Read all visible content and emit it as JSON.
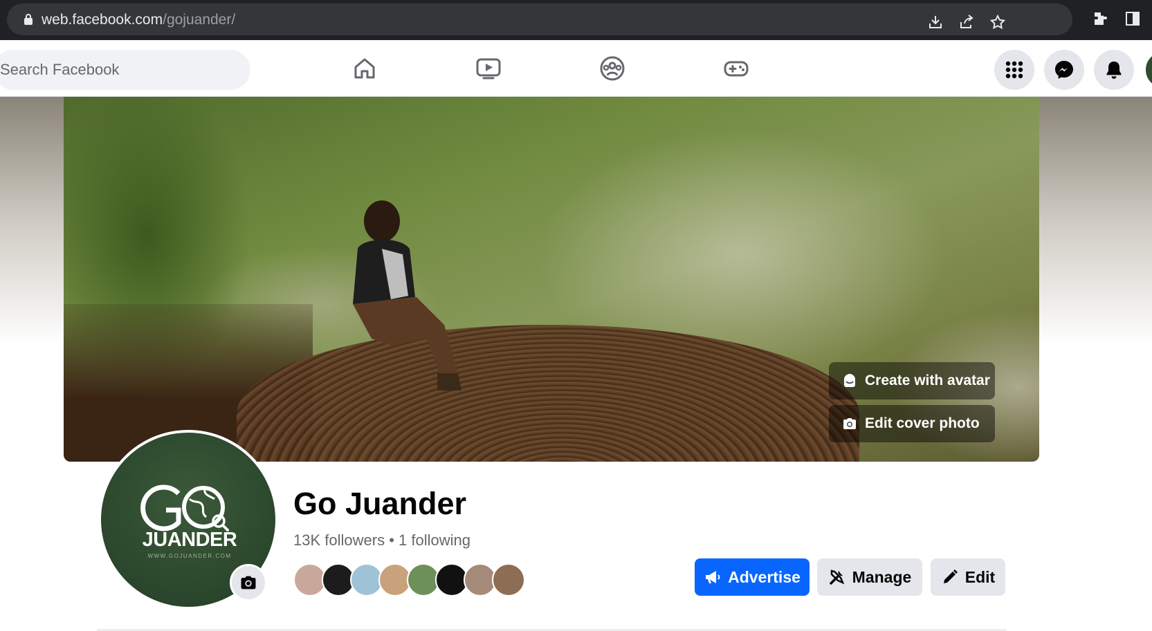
{
  "browser": {
    "url_host": "web.facebook.com",
    "url_path": "/gojuander/"
  },
  "search": {
    "placeholder": "Search Facebook"
  },
  "cover": {
    "create_avatar_label": "Create with avatar",
    "edit_cover_label": "Edit cover photo"
  },
  "avatar": {
    "logo_text": "GO JUANDER",
    "logo_url_text": "WWW.GOJUANDER.COM"
  },
  "profile": {
    "name": "Go Juander",
    "followers": "13K followers",
    "separator": " • ",
    "following": "1 following"
  },
  "friend_avatar_colors": [
    "#c9a89b",
    "#1c1c1c",
    "#9fc3d6",
    "#c8a27a",
    "#6d8f5a",
    "#111111",
    "#a58a7a",
    "#8e6d55"
  ],
  "actions": {
    "advertise_label": "Advertise",
    "manage_label": "Manage",
    "edit_label": "Edit"
  },
  "colors": {
    "primary": "#0866ff",
    "chrome_bg": "#202124",
    "avatar_bg": "#2f4b30"
  }
}
